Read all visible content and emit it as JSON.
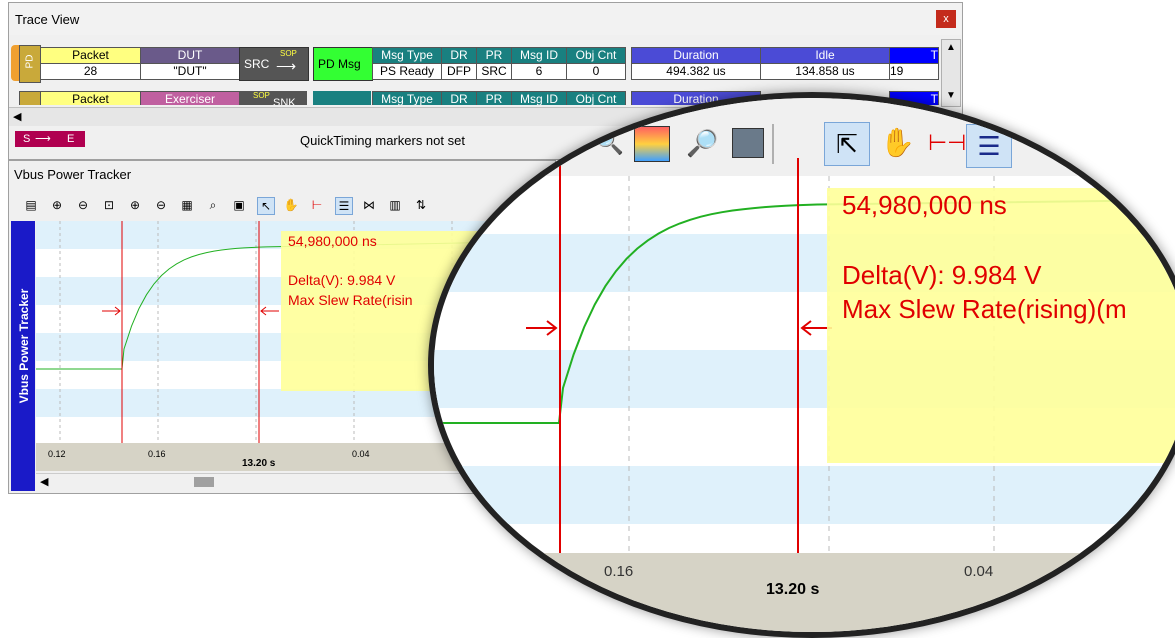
{
  "trace_view": {
    "title": "Trace View",
    "close_label": "x",
    "row1": {
      "side_label": "PD",
      "packet_header": "Packet",
      "packet_value": "28",
      "dut_header": "DUT",
      "dut_value": "\"DUT\"",
      "src_label": "SRC",
      "sop_label": "SOP",
      "pd_msg_label": "PD Msg",
      "msg_type_header": "Msg Type",
      "msg_type_value": "PS Ready",
      "dr_header": "DR",
      "dr_value": "DFP",
      "pr_header": "PR",
      "pr_value": "SRC",
      "msg_id_header": "Msg ID",
      "msg_id_value": "6",
      "obj_cnt_header": "Obj Cnt",
      "obj_cnt_value": "0",
      "duration_header": "Duration",
      "duration_value": "494.382 us",
      "idle_header": "Idle",
      "idle_value": "134.858 us",
      "t_header": "T",
      "t_value": "19"
    },
    "row2": {
      "packet_header": "Packet",
      "exerciser_header": "Exerciser",
      "sop_label": "SOP",
      "snk_label": "SNK",
      "msg_type_header": "Msg Type",
      "dr_header": "DR",
      "pr_header": "PR",
      "msg_id_header": "Msg ID",
      "obj_cnt_header": "Obj Cnt",
      "duration_header": "Duration",
      "t_header": "T"
    },
    "marker_start": "S",
    "marker_end": "E",
    "quicktiming_text": "QuickTiming markers not set"
  },
  "vbus_tracker": {
    "title": "Vbus Power Tracker",
    "side_label": "Vbus Power Tracker",
    "time_readout": "54,980,000 ns",
    "delta_text": "Delta(V): 9.984 V",
    "slew_text": "Max Slew Rate(rising)(m",
    "slew_text_short": "Max Slew Rate(risin",
    "axis_ticks": [
      "0.12",
      "0.16",
      "0.04"
    ],
    "axis_marker": "13.20 s",
    "toolbar_icons": [
      "csv-icon",
      "zoom-in-icon",
      "zoom-out-icon",
      "zoom-fit-icon",
      "zoom-in-x-icon",
      "zoom-out-x-icon",
      "palette-icon",
      "search-icon",
      "monitor-icon",
      "pointer-icon",
      "hand-icon",
      "measure-icon",
      "list-icon",
      "bowtie-icon",
      "bars-icon",
      "sort-icon"
    ]
  },
  "magnifier": {
    "time_readout": "54,980,000 ns",
    "delta_text": "Delta(V): 9.984 V",
    "slew_text": "Max Slew Rate(rising)(m",
    "axis_ticks": [
      "0.16",
      "0.04"
    ],
    "axis_marker": "13.20 s"
  },
  "colors": {
    "packet_header": "#ffff80",
    "dut_header": "#6a5a8a",
    "src_block": "#555555",
    "pd_msg": "#33ff33",
    "teal_header": "#198080",
    "duration_header": "#4b4bd6",
    "t_header": "#0000ff",
    "exerciser_header": "#c060a0",
    "trace_line": "#22b022",
    "marker_line": "#e00000",
    "readout_box": "#ffff99",
    "readout_text": "#e00000",
    "plot_band": "#dff1fb",
    "side_bar": "#1a1ac8"
  }
}
